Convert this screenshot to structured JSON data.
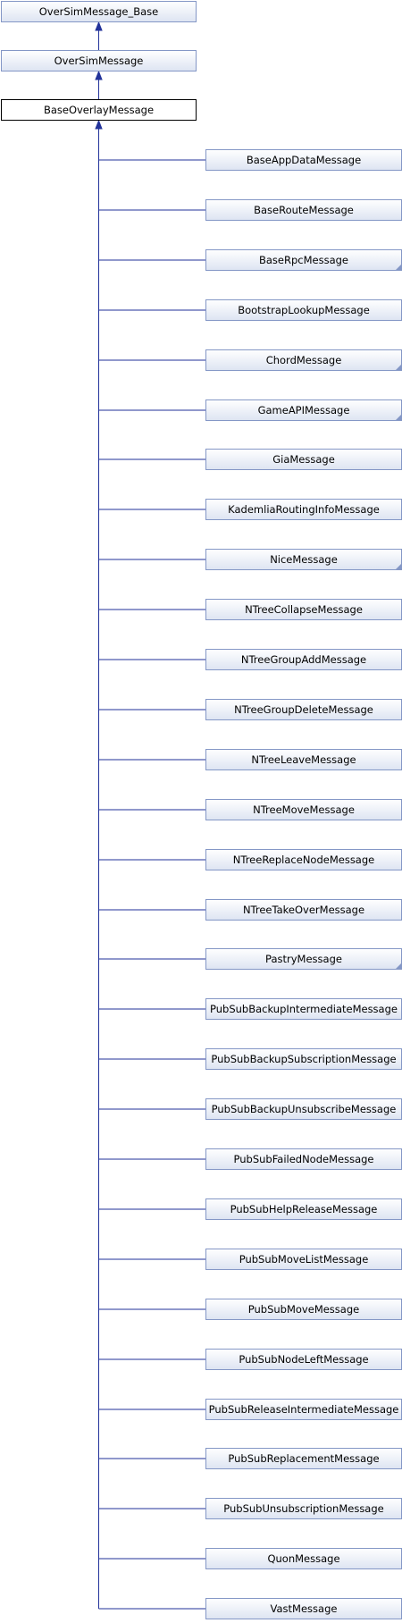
{
  "diagram": {
    "ancestors": [
      {
        "label": "OverSimMessage_Base"
      },
      {
        "label": "OverSimMessage"
      }
    ],
    "root": {
      "label": "BaseOverlayMessage"
    },
    "children": [
      {
        "label": "BaseAppDataMessage",
        "has_more": false
      },
      {
        "label": "BaseRouteMessage",
        "has_more": false
      },
      {
        "label": "BaseRpcMessage",
        "has_more": true
      },
      {
        "label": "BootstrapLookupMessage",
        "has_more": false
      },
      {
        "label": "ChordMessage",
        "has_more": true
      },
      {
        "label": "GameAPIMessage",
        "has_more": true
      },
      {
        "label": "GiaMessage",
        "has_more": false
      },
      {
        "label": "KademliaRoutingInfoMessage",
        "has_more": false
      },
      {
        "label": "NiceMessage",
        "has_more": true
      },
      {
        "label": "NTreeCollapseMessage",
        "has_more": false
      },
      {
        "label": "NTreeGroupAddMessage",
        "has_more": false
      },
      {
        "label": "NTreeGroupDeleteMessage",
        "has_more": false
      },
      {
        "label": "NTreeLeaveMessage",
        "has_more": false
      },
      {
        "label": "NTreeMoveMessage",
        "has_more": false
      },
      {
        "label": "NTreeReplaceNodeMessage",
        "has_more": false
      },
      {
        "label": "NTreeTakeOverMessage",
        "has_more": false
      },
      {
        "label": "PastryMessage",
        "has_more": true
      },
      {
        "label": "PubSubBackupIntermediateMessage",
        "has_more": false
      },
      {
        "label": "PubSubBackupSubscriptionMessage",
        "has_more": false
      },
      {
        "label": "PubSubBackupUnsubscribeMessage",
        "has_more": false
      },
      {
        "label": "PubSubFailedNodeMessage",
        "has_more": false
      },
      {
        "label": "PubSubHelpReleaseMessage",
        "has_more": false
      },
      {
        "label": "PubSubMoveListMessage",
        "has_more": false
      },
      {
        "label": "PubSubMoveMessage",
        "has_more": false
      },
      {
        "label": "PubSubNodeLeftMessage",
        "has_more": false
      },
      {
        "label": "PubSubReleaseIntermediateMessage",
        "has_more": false
      },
      {
        "label": "PubSubReplacementMessage",
        "has_more": false
      },
      {
        "label": "PubSubUnsubscriptionMessage",
        "has_more": false
      },
      {
        "label": "QuonMessage",
        "has_more": false
      },
      {
        "label": "VastMessage",
        "has_more": false
      }
    ],
    "colors": {
      "edge": "#22329a",
      "box_border": "#8497c6",
      "box_fill_top": "#ffffff",
      "box_fill_bottom": "#dde4f2",
      "current_border": "#000000"
    }
  }
}
